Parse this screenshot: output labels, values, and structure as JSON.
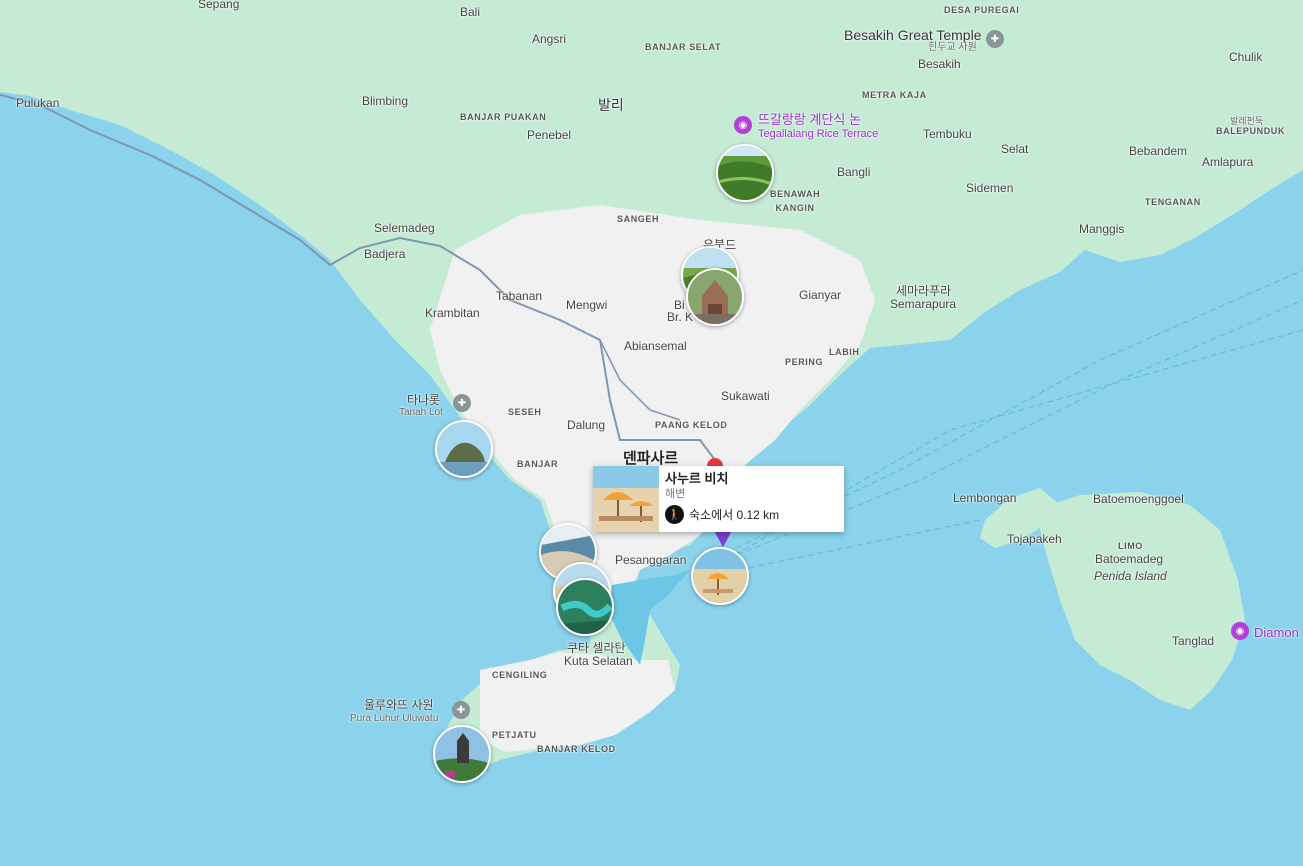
{
  "labels": {
    "sepang": "Sepang",
    "bali_top": "Bali",
    "angsri": "Angsri",
    "banjar_selat": "BANJAR SELAT",
    "desa_puregai": "DESA PUREGAI",
    "besakih_temple": "Besakih Great Temple",
    "hindu_temple": "힌두교 사원",
    "besakih": "Besakih",
    "chulik": "Chulik",
    "pulukan": "Pulukan",
    "blimbing": "Blimbing",
    "bali_kr": "발리",
    "metra_kaja": "METRA KAJA",
    "banjar_puakan": "BANJAR PUAKAN",
    "penebel": "Penebel",
    "tegallalang_kr": "뜨갈랑랑 계단식 논",
    "tegallalang_en": "Tegallalang Rice Terrace",
    "tembuku": "Tembuku",
    "balepunduk_kr": "발레펀둑",
    "balepunduk": "BALEPUNDUK",
    "selat": "Selat",
    "bebandem": "Bebandem",
    "amlapura": "Amlapura",
    "bangli": "Bangli",
    "benawah_kangin": "BENAWAH\nKANGIN",
    "sidemen": "Sidemen",
    "tenganan": "TENGANAN",
    "sangeh": "SANGEH",
    "selemadeg": "Selemadeg",
    "badjera": "Badjera",
    "manggis": "Manggis",
    "ubud": "우붓드",
    "tabanan": "Tabanan",
    "mengwi": "Mengwi",
    "br_k": "Br. K",
    "bi": "Bi",
    "gianyar": "Gianyar",
    "semarapura_kr": "세마라푸라",
    "semarapura": "Semarapura",
    "krambitan": "Krambitan",
    "abiansemal": "Abiansemal",
    "labih": "LABIH",
    "pering": "PERING",
    "tanahlot_kr": "타나롯",
    "tanahlot_en": "Tanah Lot",
    "seseh": "SESEH",
    "sukawati": "Sukawati",
    "dalung": "Dalung",
    "paang_kelod": "PAANG KELOD",
    "denpasar_kr": "덴파사르",
    "banjar": "BANJAR",
    "lembongan": "Lembongan",
    "batoemoenggoel": "Batoemoenggoel",
    "tojapakeh": "Tojapakeh",
    "limo": "LIMO",
    "batoemadeg": "Batoemadeg",
    "penida_island": "Penida Island",
    "pesanggaran": "Pesanggaran",
    "tanglad": "Tanglad",
    "diamond": "Diamon",
    "kuta_selatan_kr": "쿠타 셀라탄",
    "kuta_selatan": "Kuta Selatan",
    "cengiling": "CENGILING",
    "uluwatu_kr": "울루와뜨 사원",
    "uluwatu_en": "Pura Luhur Uluwatu",
    "petjatu": "PETJATU",
    "banjar_kelod": "BANJAR KELOD"
  },
  "card": {
    "title": "사누르 비치",
    "category": "해변",
    "distance": "숙소에서 0.12 km"
  },
  "colors": {
    "sea": "#8bd3ec",
    "land_green": "#c5ebd5",
    "land_urban": "#f2f2f2",
    "road": "#7f96b3",
    "poi": "#9334c9"
  },
  "icons": {
    "poi_camera": "camera-icon",
    "temple": "temple-icon",
    "walk": "walking-person-icon"
  }
}
